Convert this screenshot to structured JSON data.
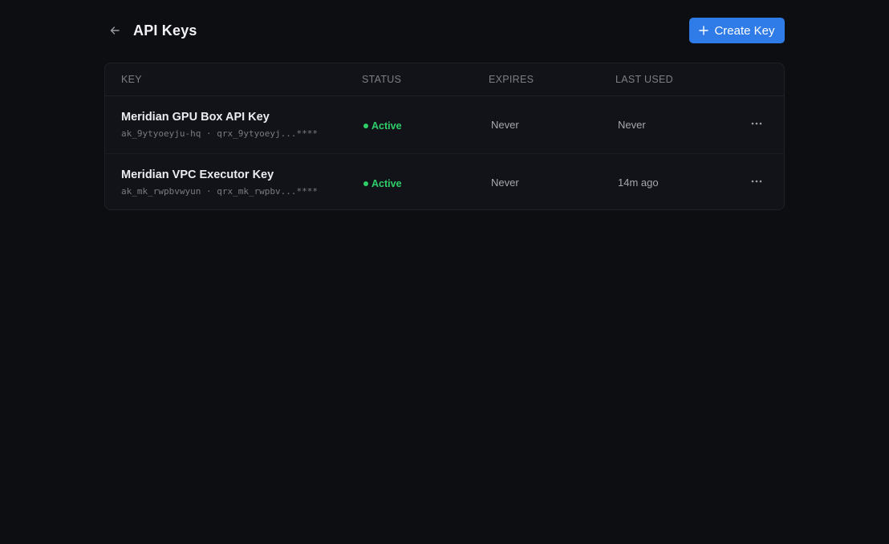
{
  "header": {
    "title": "API Keys",
    "back_icon": "arrow-left-icon",
    "create_button": {
      "label": "Create Key",
      "icon": "plus-icon",
      "color": "#2f7be8"
    }
  },
  "table": {
    "columns": [
      "KEY",
      "STATUS",
      "EXPIRES",
      "LAST USED"
    ],
    "rows": [
      {
        "name": "Meridian GPU Box API Key",
        "key_id": "ak_9ytyoeyju-hq · qrx_9ytyoeyj...****",
        "status": "Active",
        "expires": "Never",
        "last_used": "Never",
        "actions_icon": "more-horizontal-icon"
      },
      {
        "name": "Meridian VPC Executor Key",
        "key_id": "ak_mk_rwpbvwyun · qrx_mk_rwpbv...****",
        "status": "Active",
        "expires": "Never",
        "last_used": "14m ago",
        "actions_icon": "more-horizontal-icon"
      }
    ]
  },
  "colors": {
    "background": "#0d0e12",
    "status_active": "#2ecf6b",
    "accent": "#2f7be8"
  }
}
